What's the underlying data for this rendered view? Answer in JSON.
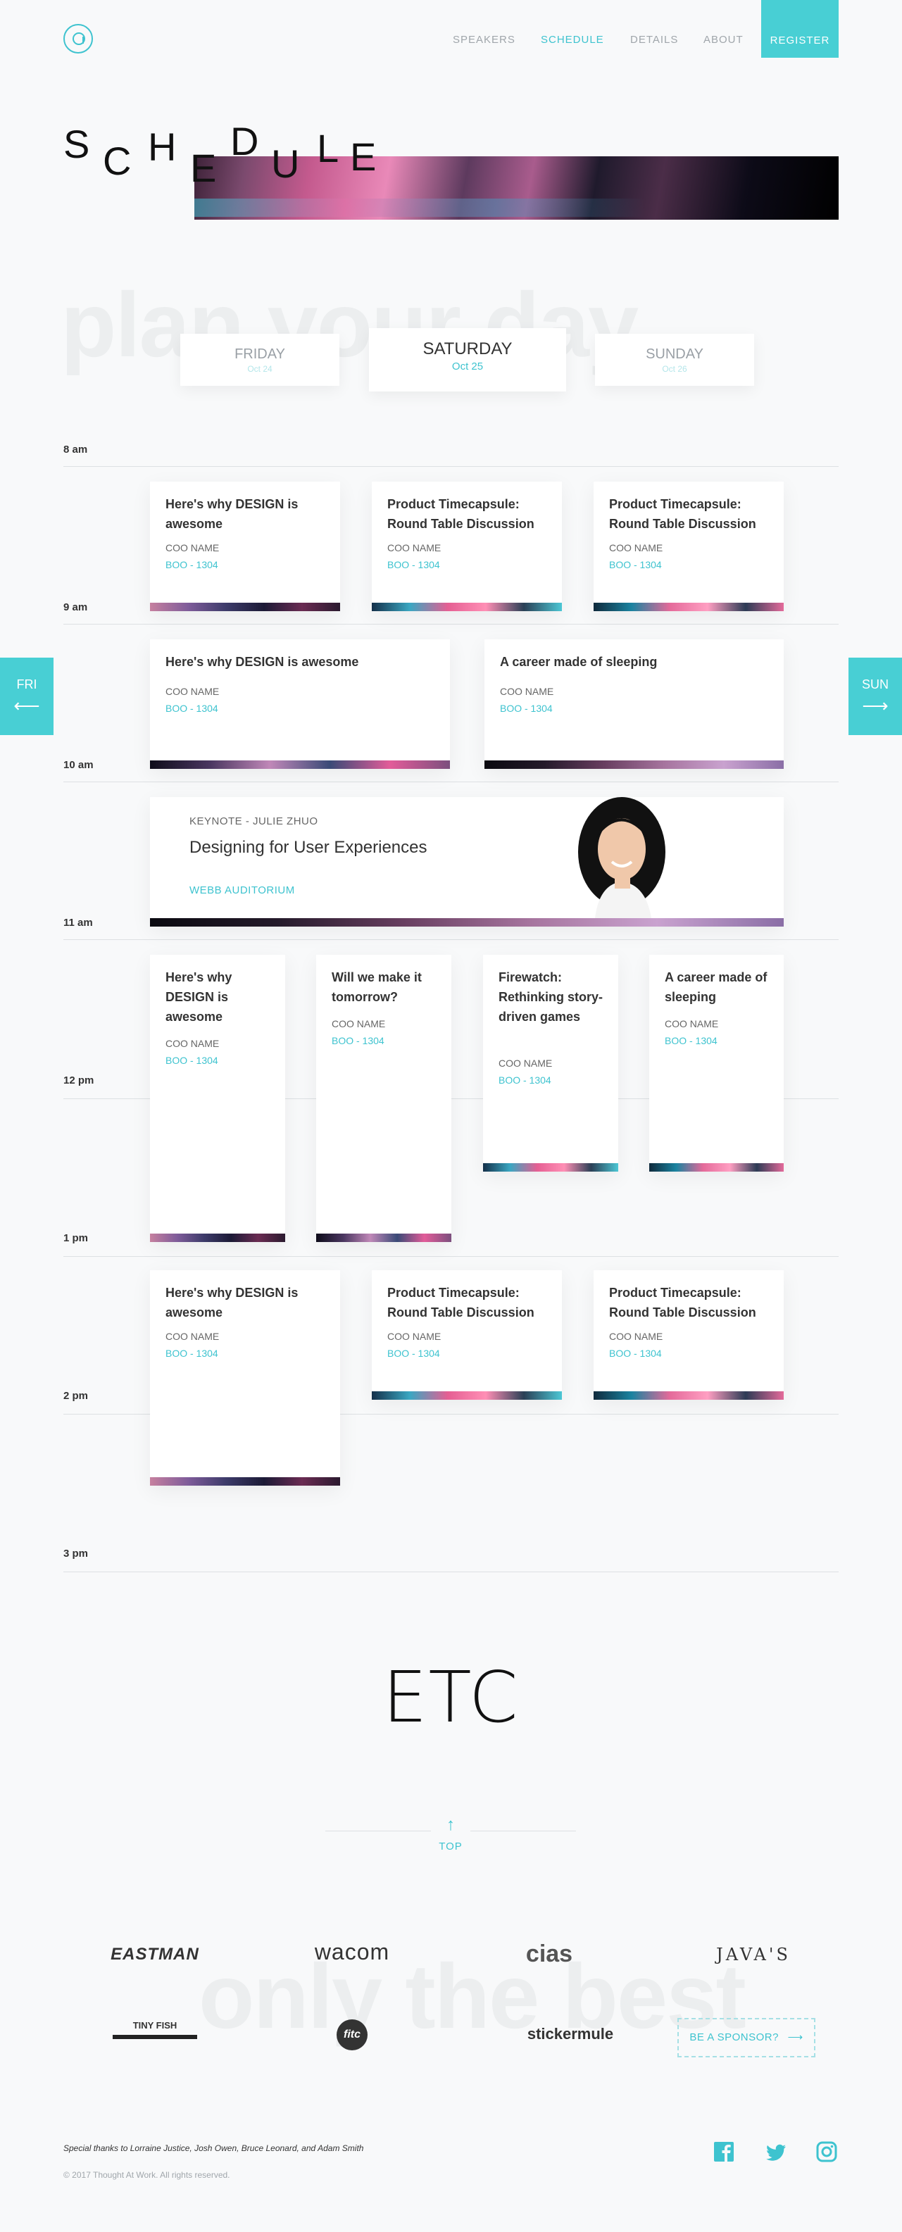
{
  "nav": {
    "items": [
      "SPEAKERS",
      "SCHEDULE",
      "DETAILS",
      "ABOUT"
    ],
    "active_index": 1,
    "register": "REGISTER"
  },
  "hero": {
    "letters": [
      "S",
      "C",
      "H",
      "E",
      "D",
      "U",
      "L",
      "E"
    ]
  },
  "ghost": {
    "plan": "plan your day",
    "best": "only the best"
  },
  "days": [
    {
      "name": "FRIDAY",
      "date": "Oct 24"
    },
    {
      "name": "SATURDAY",
      "date": "Oct 25"
    },
    {
      "name": "SUNDAY",
      "date": "Oct 26"
    }
  ],
  "times": [
    "8 am",
    "9 am",
    "10 am",
    "11 am",
    "12 pm",
    "1 pm",
    "2 pm",
    "3 pm"
  ],
  "sessions": [
    {
      "title": "Here's why DESIGN is awesome",
      "company": "COO NAME",
      "room": "BOO - 1304"
    },
    {
      "title": "Product Timecapsule: Round Table Discussion",
      "company": "COO NAME",
      "room": "BOO - 1304"
    },
    {
      "title": "Product Timecapsule: Round Table Discussion",
      "company": "COO NAME",
      "room": "BOO - 1304"
    },
    {
      "title": "Here's why DESIGN is awesome",
      "company": "COO NAME",
      "room": "BOO - 1304"
    },
    {
      "title": "A career made of sleeping",
      "company": "COO NAME",
      "room": "BOO - 1304"
    },
    {
      "title": "Here's why DESIGN is awesome",
      "company": "COO NAME",
      "room": "BOO - 1304"
    },
    {
      "title": "Will we make it tomorrow?",
      "company": "COO NAME",
      "room": "BOO - 1304"
    },
    {
      "title": "Firewatch: Rethinking story-driven games",
      "company": "COO NAME",
      "room": "BOO - 1304"
    },
    {
      "title": "A career made of sleeping",
      "company": "COO NAME",
      "room": "BOO - 1304"
    },
    {
      "title": "Here's why DESIGN is awesome",
      "company": "COO NAME",
      "room": "BOO - 1304"
    },
    {
      "title": "Product Timecapsule: Round Table Discussion",
      "company": "COO NAME",
      "room": "BOO - 1304"
    },
    {
      "title": "Product Timecapsule: Round Table Discussion",
      "company": "COO NAME",
      "room": "BOO - 1304"
    }
  ],
  "keynote": {
    "label": "KEYNOTE - JULIE ZHUO",
    "title": "Designing for User Experiences",
    "room": "WEBB AUDITORIUM"
  },
  "side": {
    "prev": "FRI",
    "next": "SUN",
    "prev_icon": "arrow-left-icon",
    "next_icon": "arrow-right-icon"
  },
  "etc": "ETC",
  "top": "TOP",
  "sponsors": [
    "EASTMAN",
    "wacom",
    "cias",
    "JAVA'S",
    "TINY FISH",
    "fitc",
    "stickermule"
  ],
  "sponsor_cta": "BE A SPONSOR?",
  "credits": "Special thanks to Lorraine Justice, Josh Owen, Bruce Leonard, and Adam Smith",
  "copyright": "© 2017 Thought At Work. All rights reserved.",
  "social": [
    "facebook-icon",
    "twitter-icon",
    "instagram-icon"
  ],
  "colors": {
    "accent": "#48cfd4",
    "accent_text": "#3ec3cf"
  }
}
